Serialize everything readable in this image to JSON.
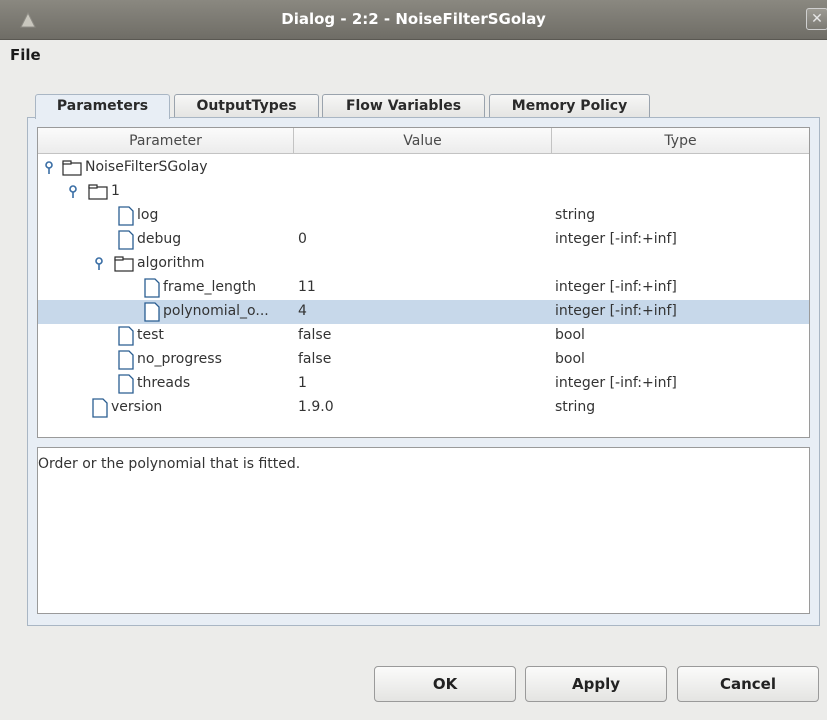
{
  "window": {
    "title": "Dialog - 2:2 - NoiseFilterSGolay",
    "close_glyph": "✕"
  },
  "menu": {
    "file": "File"
  },
  "tabs": [
    {
      "label": "Parameters"
    },
    {
      "label": "OutputTypes"
    },
    {
      "label": "Flow Variables"
    },
    {
      "label": "Memory Policy"
    }
  ],
  "table": {
    "headers": {
      "parameter": "Parameter",
      "value": "Value",
      "type": "Type"
    },
    "rows": [
      {
        "name": "NoiseFilterSGolay",
        "value": "",
        "type": ""
      },
      {
        "name": "1",
        "value": "",
        "type": ""
      },
      {
        "name": "log",
        "value": "",
        "type": "string"
      },
      {
        "name": "debug",
        "value": "0",
        "type": "integer [-inf:+inf]"
      },
      {
        "name": "algorithm",
        "value": "",
        "type": ""
      },
      {
        "name": "frame_length",
        "value": "11",
        "type": "integer [-inf:+inf]"
      },
      {
        "name": "polynomial_o...",
        "value": "4",
        "type": "integer [-inf:+inf]"
      },
      {
        "name": "test",
        "value": "false",
        "type": "bool"
      },
      {
        "name": "no_progress",
        "value": "false",
        "type": "bool"
      },
      {
        "name": "threads",
        "value": "1",
        "type": "integer [-inf:+inf]"
      },
      {
        "name": "version",
        "value": "1.9.0",
        "type": "string"
      }
    ]
  },
  "description": "Order or the polynomial that is fitted.",
  "buttons": {
    "ok": "OK",
    "apply": "Apply",
    "cancel": "Cancel"
  },
  "colors": {
    "selection": "#c7d8ea",
    "tree_expander": "#3a6ea5"
  }
}
